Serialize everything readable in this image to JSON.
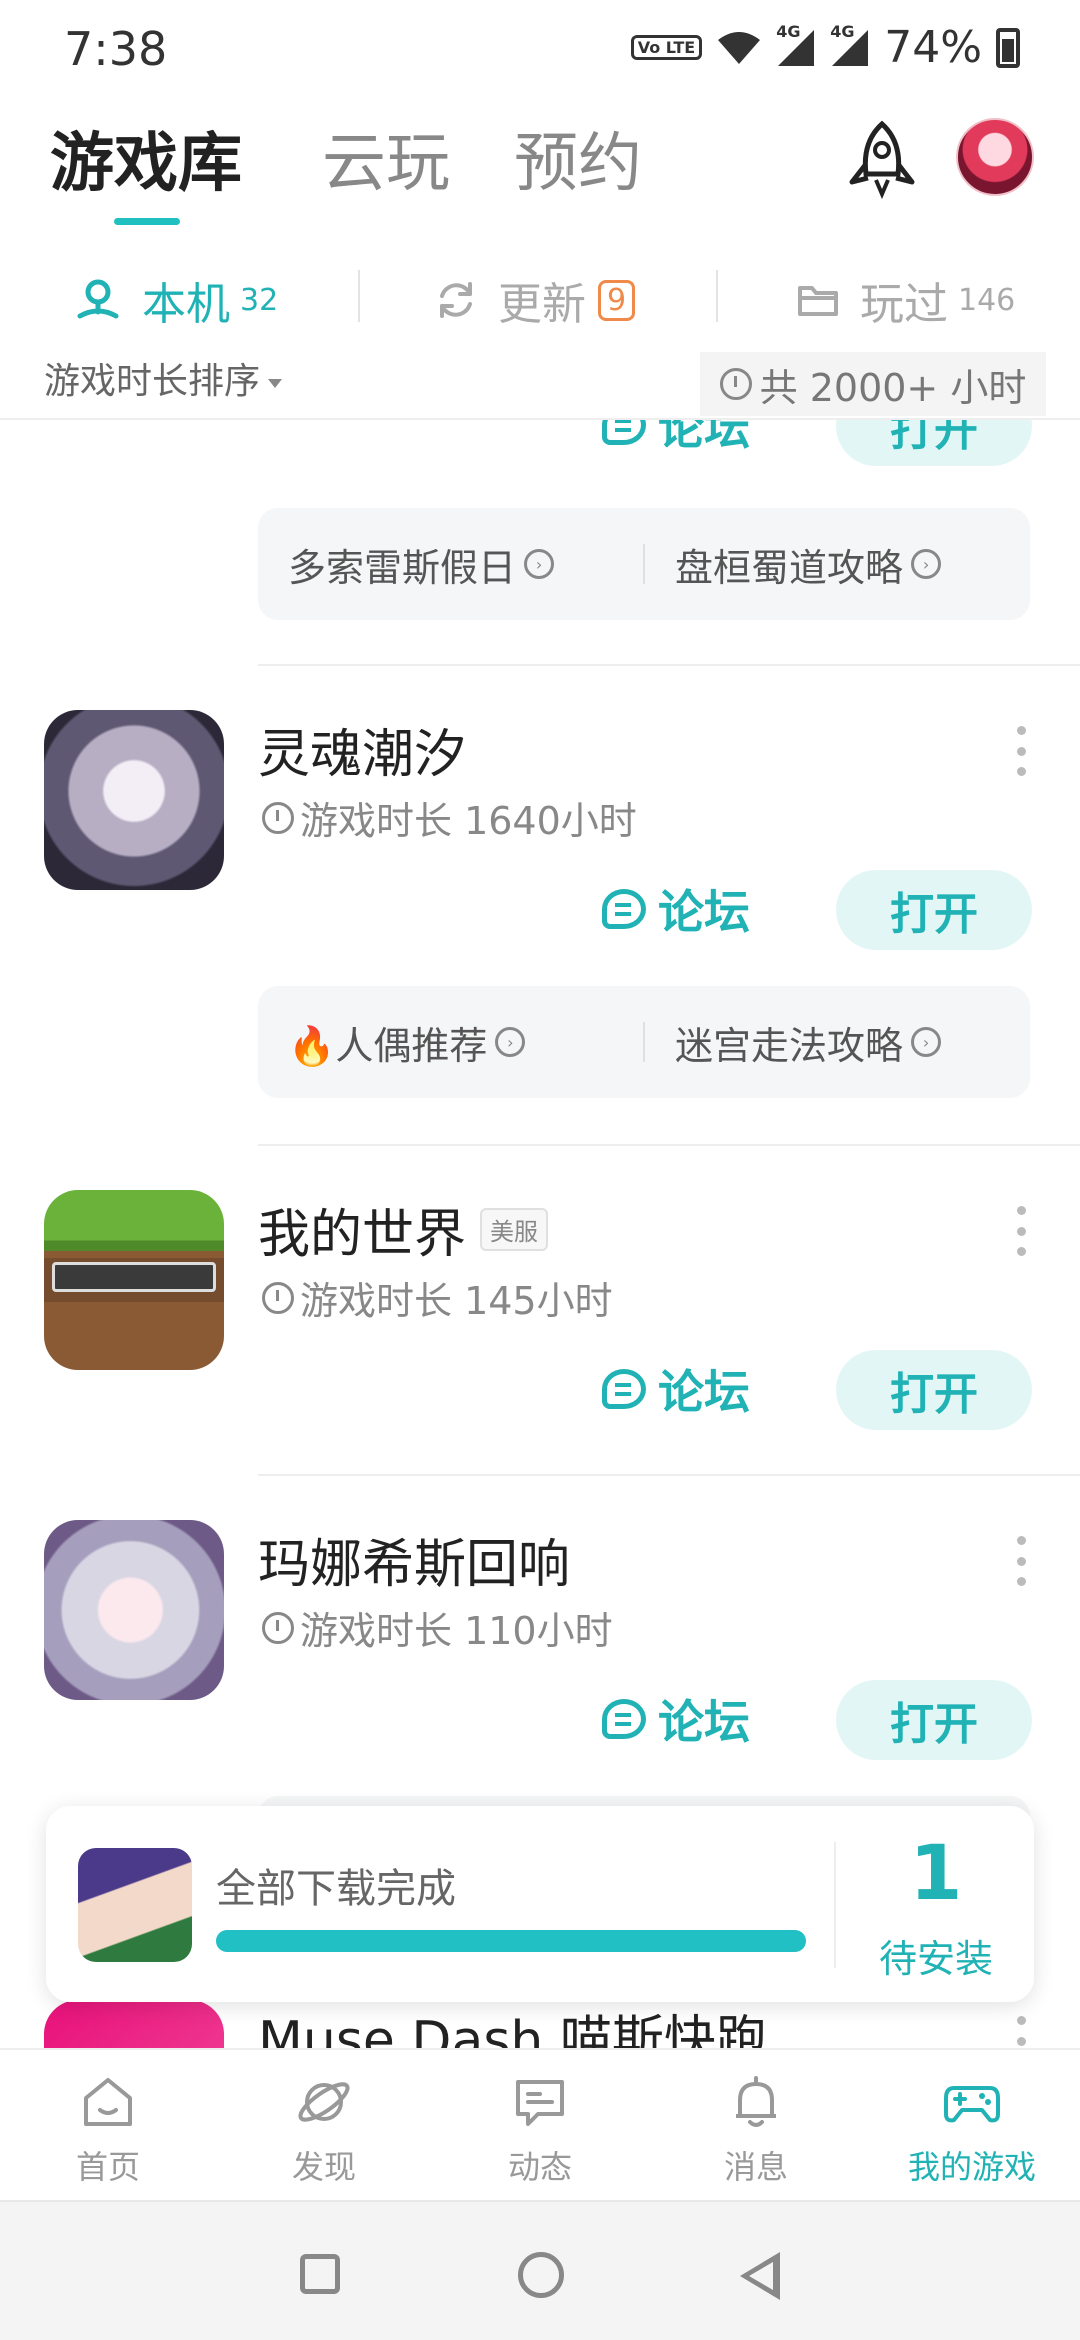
{
  "status_bar": {
    "time": "7:38",
    "volte": "Vo LTE",
    "net_label_1": "4G",
    "net_label_2": "4G",
    "battery": "74%"
  },
  "header": {
    "tabs": [
      {
        "label": "游戏库",
        "active": true
      },
      {
        "label": "云玩",
        "active": false
      },
      {
        "label": "预约",
        "active": false
      }
    ]
  },
  "subtabs": {
    "local": {
      "label": "本机",
      "count": "32"
    },
    "update": {
      "label": "更新",
      "count": "9"
    },
    "played": {
      "label": "玩过",
      "count": "146"
    }
  },
  "sort_label": "游戏时长排序",
  "total_time": "共 2000+ 小时",
  "games": [
    {
      "name": "",
      "forum": "论坛",
      "open": "打开",
      "guides": [
        "多索雷斯假日",
        "盘桓蜀道攻略"
      ]
    },
    {
      "name": "灵魂潮汐",
      "time": "游戏时长 1640小时",
      "forum": "论坛",
      "open": "打开",
      "guides": [
        "🔥人偶推荐",
        "迷宫走法攻略"
      ]
    },
    {
      "name": "我的世界",
      "tag": "美服",
      "time": "游戏时长 145小时",
      "forum": "论坛",
      "open": "打开"
    },
    {
      "name": "玛娜希斯回响",
      "time": "游戏时长 110小时",
      "forum": "论坛",
      "open": "打开"
    },
    {
      "name": "Muse Dash 喵斯快跑"
    }
  ],
  "download": {
    "text": "全部下载完成",
    "progress": 1.0,
    "count": "1",
    "label": "待安装"
  },
  "bottom_nav": [
    {
      "label": "首页",
      "icon": "home-icon",
      "active": false
    },
    {
      "label": "发现",
      "icon": "planet-icon",
      "active": false
    },
    {
      "label": "动态",
      "icon": "message-icon",
      "active": false
    },
    {
      "label": "消息",
      "icon": "bell-icon",
      "active": false
    },
    {
      "label": "我的游戏",
      "icon": "gamepad-icon",
      "active": true
    }
  ],
  "colors": {
    "accent": "#20b2b4",
    "update_badge": "#f08a4b"
  }
}
